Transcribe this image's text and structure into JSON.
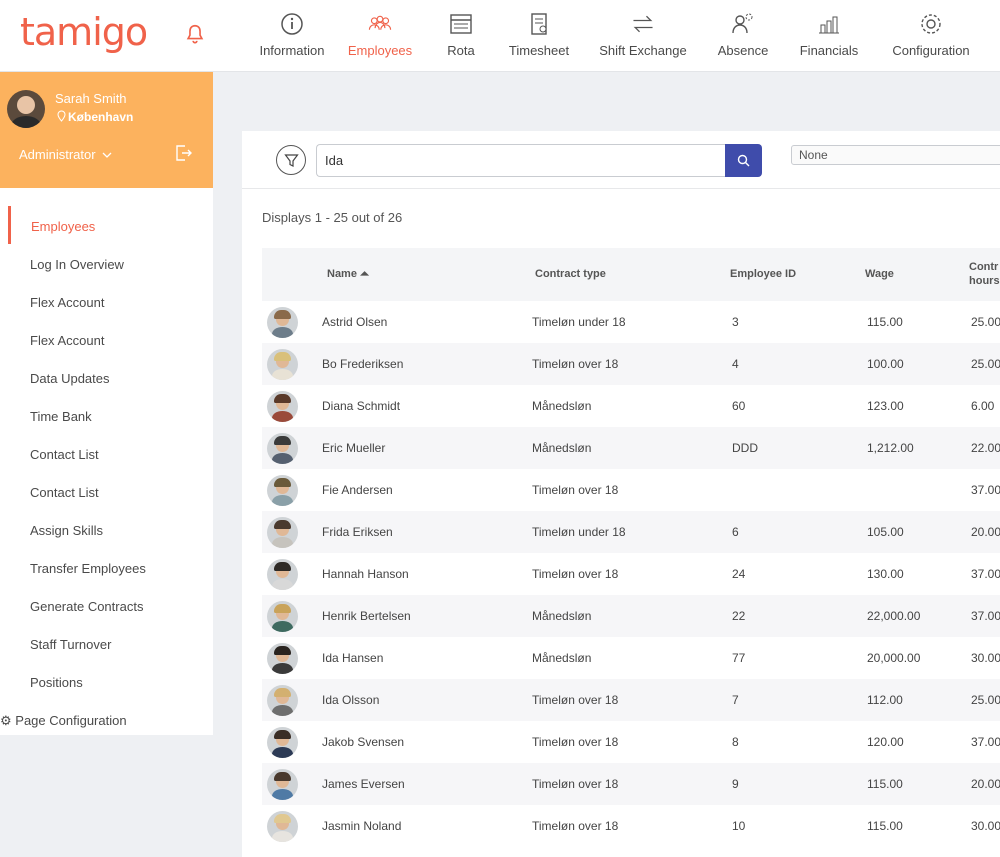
{
  "brand": {
    "logo": "tamigo",
    "accent": "#f0624a",
    "profile_bg": "#fcb25e",
    "button_blue": "#3f4cab"
  },
  "nav": [
    {
      "label": "Information",
      "icon": "info-icon",
      "active": false
    },
    {
      "label": "Employees",
      "icon": "people-icon",
      "active": true
    },
    {
      "label": "Rota",
      "icon": "calendar-icon",
      "active": false
    },
    {
      "label": "Timesheet",
      "icon": "timesheet-icon",
      "active": false
    },
    {
      "label": "Shift Exchange",
      "icon": "exchange-arrows-icon",
      "active": false
    },
    {
      "label": "Absence",
      "icon": "absence-icon",
      "active": false
    },
    {
      "label": "Financials",
      "icon": "financials-icon",
      "active": false
    },
    {
      "label": "Configuration",
      "icon": "gear-icon",
      "active": false
    }
  ],
  "profile": {
    "name": "Sarah Smith",
    "location": "København",
    "role": "Administrator"
  },
  "sidebar": {
    "items": [
      "Employees",
      "Log In Overview",
      "Flex Account",
      "Flex Account",
      "Data Updates",
      "Time Bank",
      "Contact List",
      "Contact List",
      "Assign Skills",
      "Transfer Employees",
      "Generate Contracts",
      "Staff Turnover",
      "Positions"
    ],
    "extra": "Page Configuration"
  },
  "search": {
    "value": "Ida",
    "placeholder": ""
  },
  "select": {
    "value": "None"
  },
  "displays": "Displays 1 - 25 out of 26",
  "table": {
    "columns": [
      "Name ⏶",
      "Contract type",
      "Employee ID",
      "Wage",
      "Contr",
      "hours"
    ],
    "rows": [
      {
        "name": "Astrid Olsen",
        "contract": "Timeløn under 18",
        "id": "3",
        "wage": "115.00",
        "hours": "25.00"
      },
      {
        "name": "Bo Frederiksen",
        "contract": "Timeløn over 18",
        "id": "4",
        "wage": "100.00",
        "hours": "25.00"
      },
      {
        "name": "Diana Schmidt",
        "contract": "Månedsløn",
        "id": "60",
        "wage": "123.00",
        "hours": "6.00"
      },
      {
        "name": "Eric Mueller",
        "contract": "Månedsløn",
        "id": "DDD",
        "wage": "1,212.00",
        "hours": "22.00"
      },
      {
        "name": "Fie Andersen",
        "contract": "Timeløn over 18",
        "id": "",
        "wage": "",
        "hours": "37.00"
      },
      {
        "name": "Frida Eriksen",
        "contract": "Timeløn under 18",
        "id": "6",
        "wage": "105.00",
        "hours": "20.00"
      },
      {
        "name": "Hannah Hanson",
        "contract": "Timeløn over 18",
        "id": "24",
        "wage": "130.00",
        "hours": "37.00"
      },
      {
        "name": "Henrik Bertelsen",
        "contract": "Månedsløn",
        "id": "22",
        "wage": "22,000.00",
        "hours": "37.00"
      },
      {
        "name": "Ida Hansen",
        "contract": "Månedsløn",
        "id": "77",
        "wage": "20,000.00",
        "hours": "30.00"
      },
      {
        "name": "Ida Olsson",
        "contract": "Timeløn over 18",
        "id": "7",
        "wage": "112.00",
        "hours": "25.00"
      },
      {
        "name": "Jakob Svensen",
        "contract": "Timeløn over 18",
        "id": "8",
        "wage": "120.00",
        "hours": "37.00"
      },
      {
        "name": "James Eversen",
        "contract": "Timeløn over 18",
        "id": "9",
        "wage": "115.00",
        "hours": "20.00"
      },
      {
        "name": "Jasmin Noland",
        "contract": "Timeløn over 18",
        "id": "10",
        "wage": "115.00",
        "hours": "30.00"
      }
    ]
  }
}
